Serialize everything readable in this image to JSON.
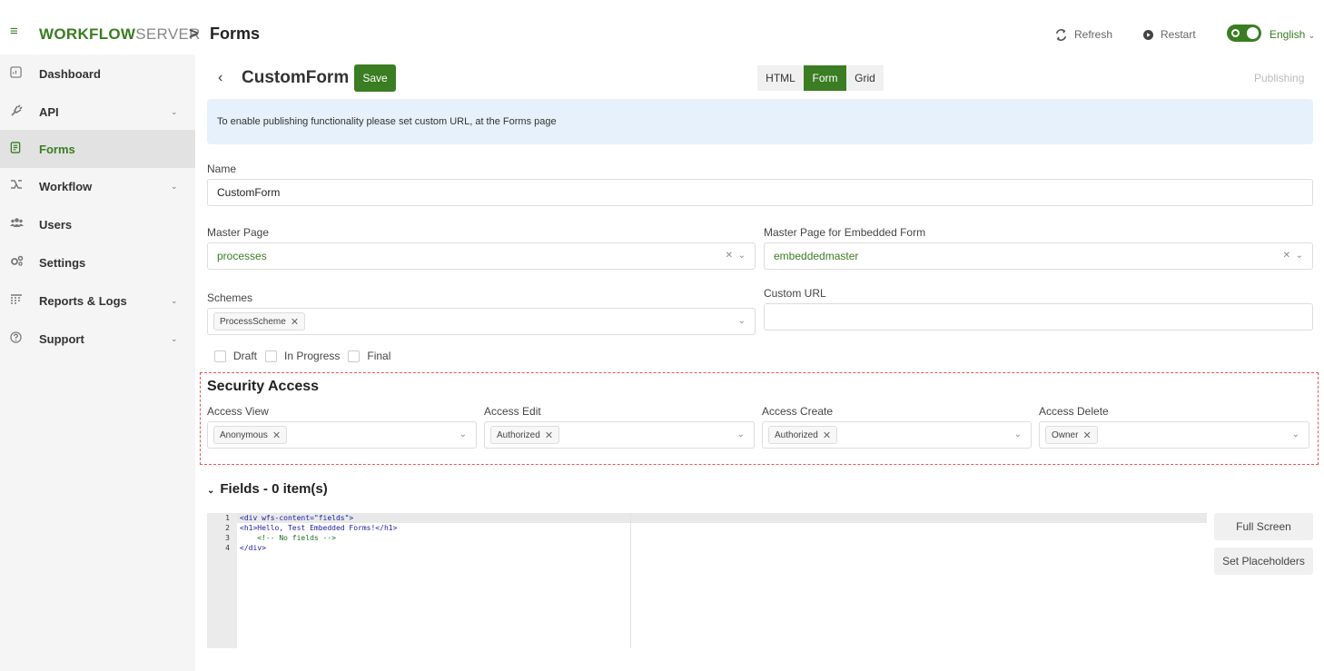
{
  "header": {
    "logo_bold": "WORKFLOW",
    "logo_light": "SERVER",
    "separator": ">",
    "breadcrumb": "Forms",
    "refresh_label": "Refresh",
    "restart_label": "Restart",
    "language": "English",
    "menu_icon": "hamburger-icon",
    "refresh_icon": "refresh-icon",
    "restart_icon": "play-icon"
  },
  "sidebar": {
    "items": [
      {
        "label": "Dashboard",
        "icon": "dashboard-icon",
        "expandable": false,
        "active": false
      },
      {
        "label": "API",
        "icon": "plug-icon",
        "expandable": true,
        "active": false
      },
      {
        "label": "Forms",
        "icon": "form-icon",
        "expandable": false,
        "active": true
      },
      {
        "label": "Workflow",
        "icon": "workflow-icon",
        "expandable": true,
        "active": false
      },
      {
        "label": "Users",
        "icon": "users-icon",
        "expandable": false,
        "active": false
      },
      {
        "label": "Settings",
        "icon": "gears-icon",
        "expandable": false,
        "active": false
      },
      {
        "label": "Reports & Logs",
        "icon": "reports-icon",
        "expandable": true,
        "active": false
      },
      {
        "label": "Support",
        "icon": "help-icon",
        "expandable": true,
        "active": false
      }
    ]
  },
  "form": {
    "back_icon": "chevron-left-icon",
    "title": "CustomForm",
    "save_label": "Save",
    "view_tabs": [
      {
        "label": "HTML",
        "active": false
      },
      {
        "label": "Form",
        "active": true
      },
      {
        "label": "Grid",
        "active": false
      }
    ],
    "publishing_label": "Publishing",
    "info_message": "To enable publishing functionality please set custom URL, at the Forms page",
    "name_label": "Name",
    "name_value": "CustomForm",
    "master_page_label": "Master Page",
    "master_page_value": "processes",
    "master_embedded_label": "Master Page for Embedded Form",
    "master_embedded_value": "embeddedmaster",
    "schemes_label": "Schemes",
    "schemes_tags": [
      "ProcessScheme"
    ],
    "custom_url_label": "Custom URL",
    "custom_url_value": "",
    "status_checks": [
      {
        "label": "Draft",
        "checked": false
      },
      {
        "label": "In Progress",
        "checked": false
      },
      {
        "label": "Final",
        "checked": false
      }
    ]
  },
  "security": {
    "title": "Security Access",
    "access_view_label": "Access View",
    "access_view_tag": "Anonymous",
    "access_edit_label": "Access Edit",
    "access_edit_tag": "Authorized",
    "access_create_label": "Access Create",
    "access_create_tag": "Authorized",
    "access_delete_label": "Access Delete",
    "access_delete_tag": "Owner"
  },
  "fields": {
    "title": "Fields - 0 item(s)",
    "code_lines": [
      {
        "num": "1",
        "text": "<div wfs-content=\"fields\">"
      },
      {
        "num": "2",
        "text": "<h1>Hello, Test Embedded Forms!</h1>"
      },
      {
        "num": "3",
        "text": "    <!-- No fields -->"
      },
      {
        "num": "4",
        "text": "</div>"
      }
    ],
    "fullscreen_label": "Full Screen",
    "placeholders_label": "Set Placeholders"
  },
  "colors": {
    "accent": "#3a7d22",
    "info_bg": "#e6f1fb",
    "danger_dash": "#e55555"
  }
}
